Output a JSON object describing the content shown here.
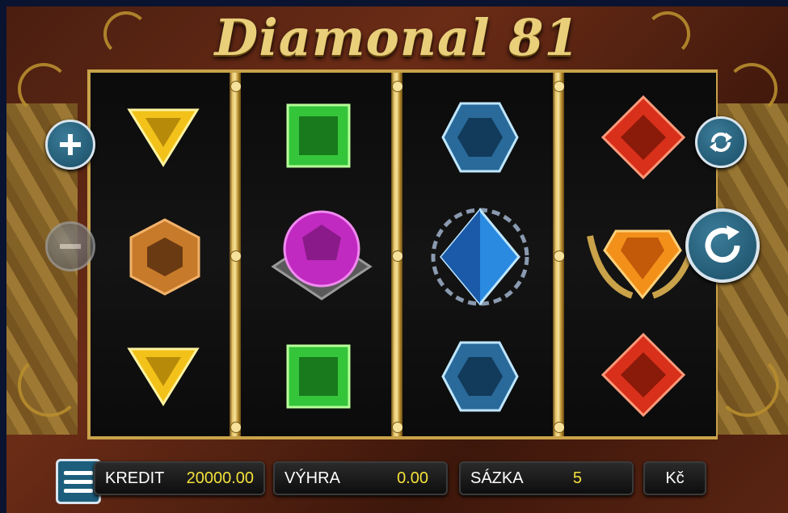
{
  "game": {
    "title": "Diamonal 81"
  },
  "reels": [
    {
      "symbols": [
        "yellow-triangle-gem",
        "amber-hexagon-gem",
        "yellow-triangle-gem"
      ]
    },
    {
      "symbols": [
        "green-square-gem",
        "purple-round-gem",
        "green-square-gem"
      ]
    },
    {
      "symbols": [
        "blue-hexagon-gem",
        "blue-diamond-gem",
        "blue-hexagon-gem"
      ]
    },
    {
      "symbols": [
        "red-diamond-gem",
        "orange-crown-gem",
        "red-diamond-gem"
      ]
    }
  ],
  "controls": {
    "plus_icon": "plus-icon",
    "minus_icon": "minus-icon",
    "autoplay_icon": "autoplay-icon",
    "spin_icon": "spin-icon",
    "menu_icon": "menu-icon"
  },
  "status_bar": {
    "credit_label": "KREDIT",
    "credit_value": "20000.00",
    "win_label": "VÝHRA",
    "win_value": "0.00",
    "bet_label": "SÁZKA",
    "bet_value": "5",
    "currency_label": "Kč"
  },
  "colors": {
    "gold": "#c9a24a",
    "value_yellow": "#f4e23a",
    "button_blue": "#1c5e7c",
    "wood": "#5a2412"
  }
}
